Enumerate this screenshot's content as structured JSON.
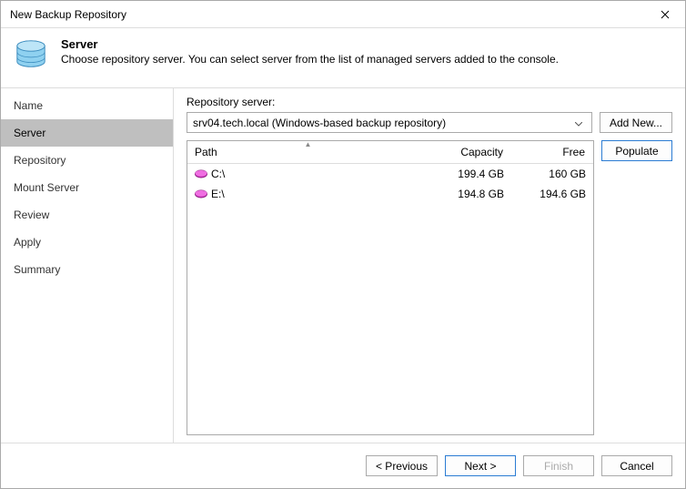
{
  "window": {
    "title": "New Backup Repository"
  },
  "header": {
    "title": "Server",
    "description": "Choose repository server. You can select server from the list of managed servers added to the console."
  },
  "sidebar": {
    "items": [
      {
        "label": "Name"
      },
      {
        "label": "Server"
      },
      {
        "label": "Repository"
      },
      {
        "label": "Mount Server"
      },
      {
        "label": "Review"
      },
      {
        "label": "Apply"
      },
      {
        "label": "Summary"
      }
    ],
    "selectedIndex": 1
  },
  "main": {
    "serverLabel": "Repository server:",
    "serverValue": "srv04.tech.local (Windows-based backup repository)",
    "addNewLabel": "Add New...",
    "populateLabel": "Populate",
    "columns": {
      "path": "Path",
      "capacity": "Capacity",
      "free": "Free"
    },
    "rows": [
      {
        "path": "C:\\",
        "capacity": "199.4 GB",
        "free": "160 GB"
      },
      {
        "path": "E:\\",
        "capacity": "194.8 GB",
        "free": "194.6 GB"
      }
    ]
  },
  "footer": {
    "previous": "< Previous",
    "next": "Next >",
    "finish": "Finish",
    "cancel": "Cancel"
  }
}
